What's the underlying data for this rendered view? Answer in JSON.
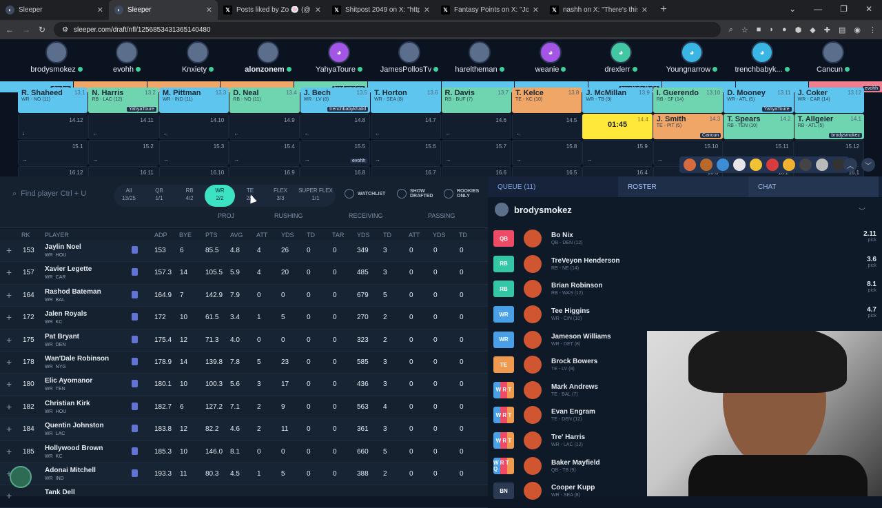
{
  "browser": {
    "tabs": [
      {
        "title": "Sleeper",
        "icon": "sleeper-icon",
        "active": false
      },
      {
        "title": "Sleeper",
        "icon": "sleeper-icon",
        "active": true
      },
      {
        "title": "Posts liked by Zo 🍥 (@alonzo...",
        "icon": "x-icon",
        "active": false
      },
      {
        "title": "Shitpost 2049 on X: \"https://t.c...",
        "icon": "x-icon",
        "active": false
      },
      {
        "title": "Fantasy Points on X: \"Josh Dow...",
        "icon": "x-icon",
        "active": false
      },
      {
        "title": "nashh on X: \"There's this guy w...",
        "icon": "x-icon",
        "active": false
      }
    ],
    "url": "sleeper.com/draft/nfl/1256853431365140480"
  },
  "teams": [
    {
      "name": "brodysmokez",
      "bold": false,
      "type": "photo"
    },
    {
      "name": "evohh",
      "bold": false,
      "type": "photo"
    },
    {
      "name": "Knxiety",
      "bold": false,
      "type": "photo"
    },
    {
      "name": "alonzonem",
      "bold": true,
      "type": "photo"
    },
    {
      "name": "YahyaToure",
      "bold": false,
      "type": "bot"
    },
    {
      "name": "JamesPollosTv",
      "bold": false,
      "type": "photo"
    },
    {
      "name": "hareltheman",
      "bold": false,
      "type": "photo"
    },
    {
      "name": "weanie",
      "bold": false,
      "type": "bot"
    },
    {
      "name": "drexlerr",
      "bold": false,
      "type": "bot-g"
    },
    {
      "name": "Youngnarrow",
      "bold": false,
      "type": "bot-b"
    },
    {
      "name": "trenchbabyk...",
      "bold": false,
      "type": "bot-b"
    },
    {
      "name": "Cancun",
      "bold": false,
      "type": "photo"
    }
  ],
  "topstrip": [
    {
      "pos": "wr",
      "tag": "drexlerr"
    },
    {
      "pos": "te",
      "tag": ""
    },
    {
      "pos": "te",
      "tag": ""
    },
    {
      "pos": "te",
      "tag": ""
    },
    {
      "pos": "rb",
      "tag": "brodysmokez"
    },
    {
      "pos": "wr",
      "tag": ""
    },
    {
      "pos": "wr",
      "tag": ""
    },
    {
      "pos": "wr",
      "tag": ""
    },
    {
      "pos": "wr",
      "tag": "trenchbabykhalid"
    },
    {
      "pos": "wr",
      "tag": ""
    },
    {
      "pos": "wr",
      "tag": ""
    },
    {
      "pos": "qb",
      "tag": "evohh"
    }
  ],
  "round13": [
    {
      "name": "R. Shaheed",
      "pos": "WR - NO (11)",
      "no": "13.1",
      "cls": "wr",
      "by": ""
    },
    {
      "name": "N. Harris",
      "pos": "RB - LAC (12)",
      "no": "13.2",
      "cls": "rb",
      "by": "YahyaToure"
    },
    {
      "name": "M. Pittman",
      "pos": "WR - IND (11)",
      "no": "13.3",
      "cls": "wr",
      "by": ""
    },
    {
      "name": "D. Neal",
      "pos": "RB - NO (11)",
      "no": "13.4",
      "cls": "rb",
      "by": ""
    },
    {
      "name": "J. Bech",
      "pos": "WR - LV (8)",
      "no": "13.5",
      "cls": "wr",
      "by": "trenchbabykhalid"
    },
    {
      "name": "T. Horton",
      "pos": "WR - SEA (8)",
      "no": "13.6",
      "cls": "wr",
      "by": ""
    },
    {
      "name": "R. Davis",
      "pos": "RB - BUF (7)",
      "no": "13.7",
      "cls": "rb",
      "by": ""
    },
    {
      "name": "T. Kelce",
      "pos": "TE - KC (10)",
      "no": "13.8",
      "cls": "te",
      "by": ""
    },
    {
      "name": "J. McMillan",
      "pos": "WR - TB (9)",
      "no": "13.9",
      "cls": "wr",
      "by": ""
    },
    {
      "name": "I. Guerendo",
      "pos": "RB - SF (14)",
      "no": "13.10",
      "cls": "rb",
      "by": ""
    },
    {
      "name": "D. Mooney",
      "pos": "WR - ATL (5)",
      "no": "13.11",
      "cls": "wr",
      "by": "YahyaToure"
    },
    {
      "name": "J. Coker",
      "pos": "WR - CAR (14)",
      "no": "13.12",
      "cls": "wr",
      "by": ""
    }
  ],
  "round14": [
    {
      "no": "14.12",
      "arrow": "↓"
    },
    {
      "no": "14.11",
      "arrow": "←"
    },
    {
      "no": "14.10",
      "arrow": "←"
    },
    {
      "no": "14.9",
      "arrow": "←"
    },
    {
      "no": "14.8",
      "arrow": "←"
    },
    {
      "no": "14.7",
      "arrow": "←"
    },
    {
      "no": "14.6",
      "arrow": "←"
    },
    {
      "no": "14.5",
      "arrow": "←"
    },
    {
      "no": "14.4",
      "timer": "01:45"
    },
    {
      "no": "14.3",
      "name": "J. Smith",
      "pos": "TE - PIT (5)",
      "cls": "te",
      "by": "Cancun"
    },
    {
      "no": "14.2",
      "name": "T. Spears",
      "pos": "RB - TEN (10)",
      "cls": "rb",
      "by": ""
    },
    {
      "no": "14.1",
      "name": "T. Allgeier",
      "pos": "RB - ATL (5)",
      "cls": "rb",
      "by": "brodysmokez"
    }
  ],
  "round15": [
    {
      "no": "15.1",
      "arrow": "→"
    },
    {
      "no": "15.2",
      "arrow": "→"
    },
    {
      "no": "15.3",
      "arrow": "→"
    },
    {
      "no": "15.4",
      "arrow": "→"
    },
    {
      "no": "15.5",
      "arrow": "→",
      "by": "evohh"
    },
    {
      "no": "15.6",
      "arrow": "→"
    },
    {
      "no": "15.7",
      "arrow": "→"
    },
    {
      "no": "15.8",
      "arrow": "→"
    },
    {
      "no": "15.9",
      "arrow": "→"
    },
    {
      "no": "15.10",
      "arrow": "→"
    },
    {
      "no": "15.11",
      "arrow": "→"
    },
    {
      "no": "15.12",
      "arrow": "↓"
    }
  ],
  "round16": [
    "16.12",
    "16.11",
    "16.10",
    "16.9",
    "16.8",
    "16.7",
    "16.6",
    "16.5",
    "16.4",
    "16.3",
    "16.2",
    "16.1"
  ],
  "search": {
    "placeholder": "Find player Ctrl + U"
  },
  "filters": [
    {
      "label": "All",
      "count": "13/25",
      "on": false
    },
    {
      "label": "QB",
      "count": "1/1",
      "on": false
    },
    {
      "label": "RB",
      "count": "4/2",
      "on": false
    },
    {
      "label": "WR",
      "count": "2/2",
      "on": true
    },
    {
      "label": "TE",
      "count": "2/1",
      "on": false
    },
    {
      "label": "FLEX",
      "count": "3/3",
      "on": false
    },
    {
      "label": "SUPER FLEX",
      "count": "1/1",
      "on": false
    }
  ],
  "toggles": {
    "watchlist": "WATCHLIST",
    "drafted": "SHOW DRAFTED",
    "rookies": "ROOKIES ONLY"
  },
  "groups": {
    "proj": "PROJ",
    "rushing": "RUSHING",
    "receiving": "RECEIVING",
    "passing": "PASSING"
  },
  "columns": {
    "rk": "RK",
    "player": "PLAYER",
    "adp": "ADP",
    "bye": "BYE",
    "pts": "PTS",
    "avg": "AVG",
    "att": "ATT",
    "yds": "YDS",
    "td": "TD",
    "tar": "TAR",
    "ryds": "YDS",
    "rtd": "TD",
    "patt": "ATT",
    "pyds": "YDS",
    "ptd": "TD"
  },
  "players": [
    {
      "rk": "153",
      "name": "Jaylin Noel",
      "pos": "WR",
      "team": "HOU",
      "adp": "153",
      "bye": "6",
      "pts": "85.5",
      "avg": "4.8",
      "att": "4",
      "yds": "26",
      "td": "0",
      "tar": "0",
      "ryds": "349",
      "rtd": "3",
      "patt": "0",
      "pyds": "0",
      "ptd": "0"
    },
    {
      "rk": "157",
      "name": "Xavier Legette",
      "pos": "WR",
      "team": "CAR",
      "adp": "157.3",
      "bye": "14",
      "pts": "105.5",
      "avg": "5.9",
      "att": "4",
      "yds": "20",
      "td": "0",
      "tar": "0",
      "ryds": "485",
      "rtd": "3",
      "patt": "0",
      "pyds": "0",
      "ptd": "0"
    },
    {
      "rk": "164",
      "name": "Rashod Bateman",
      "pos": "WR",
      "team": "BAL",
      "adp": "164.9",
      "bye": "7",
      "pts": "142.9",
      "avg": "7.9",
      "att": "0",
      "yds": "0",
      "td": "0",
      "tar": "0",
      "ryds": "679",
      "rtd": "5",
      "patt": "0",
      "pyds": "0",
      "ptd": "0"
    },
    {
      "rk": "172",
      "name": "Jalen Royals",
      "pos": "WR",
      "team": "KC",
      "adp": "172",
      "bye": "10",
      "pts": "61.5",
      "avg": "3.4",
      "att": "1",
      "yds": "5",
      "td": "0",
      "tar": "0",
      "ryds": "270",
      "rtd": "2",
      "patt": "0",
      "pyds": "0",
      "ptd": "0"
    },
    {
      "rk": "175",
      "name": "Pat Bryant",
      "pos": "WR",
      "team": "DEN",
      "adp": "175.4",
      "bye": "12",
      "pts": "71.3",
      "avg": "4.0",
      "att": "0",
      "yds": "0",
      "td": "0",
      "tar": "0",
      "ryds": "323",
      "rtd": "2",
      "patt": "0",
      "pyds": "0",
      "ptd": "0"
    },
    {
      "rk": "178",
      "name": "Wan'Dale Robinson",
      "pos": "WR",
      "team": "NYG",
      "adp": "178.9",
      "bye": "14",
      "pts": "139.8",
      "avg": "7.8",
      "att": "5",
      "yds": "23",
      "td": "0",
      "tar": "0",
      "ryds": "585",
      "rtd": "3",
      "patt": "0",
      "pyds": "0",
      "ptd": "0"
    },
    {
      "rk": "180",
      "name": "Elic Ayomanor",
      "pos": "WR",
      "team": "TEN",
      "adp": "180.1",
      "bye": "10",
      "pts": "100.3",
      "avg": "5.6",
      "att": "3",
      "yds": "17",
      "td": "0",
      "tar": "0",
      "ryds": "436",
      "rtd": "3",
      "patt": "0",
      "pyds": "0",
      "ptd": "0"
    },
    {
      "rk": "182",
      "name": "Christian Kirk",
      "pos": "WR",
      "team": "HOU",
      "adp": "182.7",
      "bye": "6",
      "pts": "127.2",
      "avg": "7.1",
      "att": "2",
      "yds": "9",
      "td": "0",
      "tar": "0",
      "ryds": "563",
      "rtd": "4",
      "patt": "0",
      "pyds": "0",
      "ptd": "0"
    },
    {
      "rk": "184",
      "name": "Quentin Johnston",
      "pos": "WR",
      "team": "LAC",
      "adp": "183.8",
      "bye": "12",
      "pts": "82.2",
      "avg": "4.6",
      "att": "2",
      "yds": "11",
      "td": "0",
      "tar": "0",
      "ryds": "361",
      "rtd": "3",
      "patt": "0",
      "pyds": "0",
      "ptd": "0"
    },
    {
      "rk": "185",
      "name": "Hollywood Brown",
      "pos": "WR",
      "team": "KC",
      "adp": "185.3",
      "bye": "10",
      "pts": "146.0",
      "avg": "8.1",
      "att": "0",
      "yds": "0",
      "td": "0",
      "tar": "0",
      "ryds": "660",
      "rtd": "5",
      "patt": "0",
      "pyds": "0",
      "ptd": "0"
    },
    {
      "rk": "",
      "name": "Adonai Mitchell",
      "pos": "WR",
      "team": "IND",
      "adp": "193.3",
      "bye": "11",
      "pts": "80.3",
      "avg": "4.5",
      "att": "1",
      "yds": "5",
      "td": "0",
      "tar": "0",
      "ryds": "388",
      "rtd": "2",
      "patt": "0",
      "pyds": "0",
      "ptd": "0"
    },
    {
      "rk": "",
      "name": "Tank Dell",
      "pos": "",
      "team": "",
      "adp": "",
      "bye": "",
      "pts": "",
      "avg": "",
      "att": "",
      "yds": "",
      "td": "",
      "tar": "",
      "ryds": "",
      "rtd": "",
      "patt": "",
      "pyds": "",
      "ptd": ""
    }
  ],
  "right_tabs": {
    "queue": "QUEUE (11)",
    "roster": "ROSTER",
    "chat": "CHAT"
  },
  "roster_user": "brodysmokez",
  "roster": [
    {
      "slot": "QB",
      "cls": "p-qb",
      "name": "Bo Nix",
      "sub": "QB - DEN (12)",
      "adp": "2.11"
    },
    {
      "slot": "RB",
      "cls": "p-rb",
      "name": "TreVeyon Henderson",
      "sub": "RB - NE (14)",
      "adp": "3.6"
    },
    {
      "slot": "RB",
      "cls": "p-rb",
      "name": "Brian Robinson",
      "sub": "RB - WAS (12)",
      "adp": "8.1"
    },
    {
      "slot": "WR",
      "cls": "p-wr",
      "name": "Tee Higgins",
      "sub": "WR - CIN (10)",
      "adp": "4.7"
    },
    {
      "slot": "WR",
      "cls": "p-wr",
      "name": "Jameson Williams",
      "sub": "WR - DET (8)",
      "adp": ""
    },
    {
      "slot": "TE",
      "cls": "p-te",
      "name": "Brock Bowers",
      "sub": "TE - LV (8)",
      "adp": ""
    },
    {
      "slot": "W R T",
      "cls": "p-fl",
      "name": "Mark Andrews",
      "sub": "TE - BAL (7)",
      "adp": ""
    },
    {
      "slot": "W R T",
      "cls": "p-fl",
      "name": "Evan Engram",
      "sub": "TE - DEN (12)",
      "adp": ""
    },
    {
      "slot": "W R T",
      "cls": "p-fl",
      "name": "Tre' Harris",
      "sub": "WR - LAC (12)",
      "adp": ""
    },
    {
      "slot": "W R T Q",
      "cls": "p-fl",
      "name": "Baker Mayfield",
      "sub": "QB - TB (9)",
      "adp": ""
    },
    {
      "slot": "BN",
      "cls": "p-bn",
      "name": "Cooper Kupp",
      "sub": "WR - SEA (8)",
      "adp": ""
    }
  ],
  "pick_label": "pick"
}
